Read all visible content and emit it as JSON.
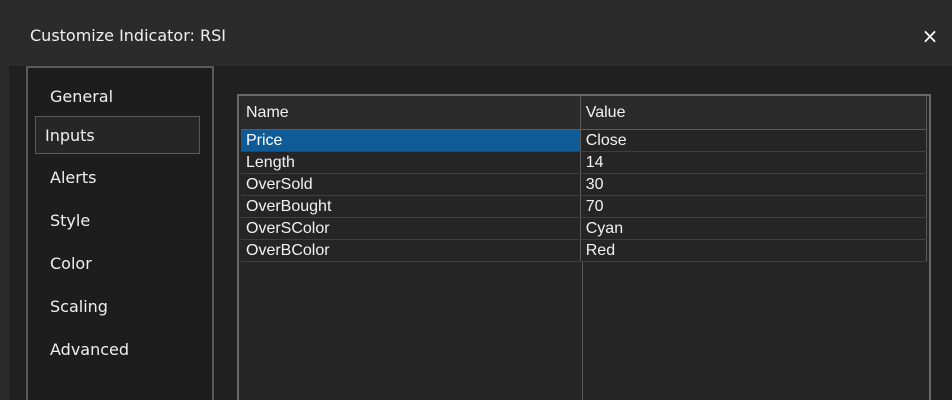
{
  "window": {
    "title": "Customize Indicator: RSI",
    "close_icon": "×"
  },
  "sidebar": {
    "items": [
      {
        "label": "General",
        "active": false
      },
      {
        "label": "Inputs",
        "active": true
      },
      {
        "label": "Alerts",
        "active": false
      },
      {
        "label": "Style",
        "active": false
      },
      {
        "label": "Color",
        "active": false
      },
      {
        "label": "Scaling",
        "active": false
      },
      {
        "label": "Advanced",
        "active": false
      }
    ]
  },
  "inputs_table": {
    "columns": [
      "Name",
      "Value"
    ],
    "rows": [
      {
        "name": "Price",
        "value": "Close"
      },
      {
        "name": "Length",
        "value": "14"
      },
      {
        "name": "OverSold",
        "value": "30"
      },
      {
        "name": "OverBought",
        "value": "70"
      },
      {
        "name": "OverSColor",
        "value": "Cyan"
      },
      {
        "name": "OverBColor",
        "value": "Red"
      }
    ],
    "selected_row": 0
  },
  "colors": {
    "background": "#2b2b2b",
    "panel": "#202020",
    "selection": "#0f5b97",
    "text": "#f0f0f0"
  }
}
